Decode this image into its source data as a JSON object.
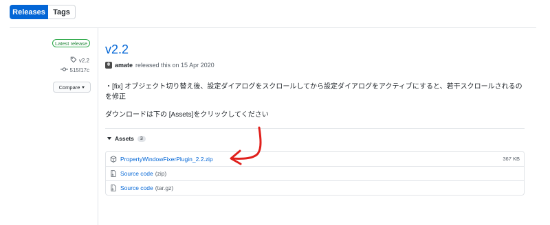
{
  "tabs": [
    {
      "label": "Releases",
      "active": true
    },
    {
      "label": "Tags",
      "active": false
    }
  ],
  "sidebar": {
    "latest_badge": "Latest release",
    "tag": "v2.2",
    "commit": "515f17c",
    "compare_label": "Compare"
  },
  "release": {
    "title": "v2.2",
    "author": "amate",
    "released_text": "released this on 15 Apr 2020",
    "note_line1": "・[fix] オブジェクト切り替え後、設定ダイアログをスクロールしてから設定ダイアログをアクティブにすると、若干スクロールされるのを修正",
    "note_line2": "ダウンロードは下の [Assets]をクリックしてください"
  },
  "assets": {
    "heading": "Assets",
    "count": "3",
    "items": [
      {
        "name": "PropertyWindowFixerPlugin_2.2.zip",
        "suffix": "",
        "size": "367 KB",
        "icon": "package-icon"
      },
      {
        "name": "Source code",
        "suffix": "(zip)",
        "size": "",
        "icon": "file-zip-icon"
      },
      {
        "name": "Source code",
        "suffix": "(tar.gz)",
        "size": "",
        "icon": "file-zip-icon"
      }
    ]
  },
  "colors": {
    "accent": "#0366d6",
    "latest_green": "#28a745",
    "annotation_red": "#e0201c"
  }
}
